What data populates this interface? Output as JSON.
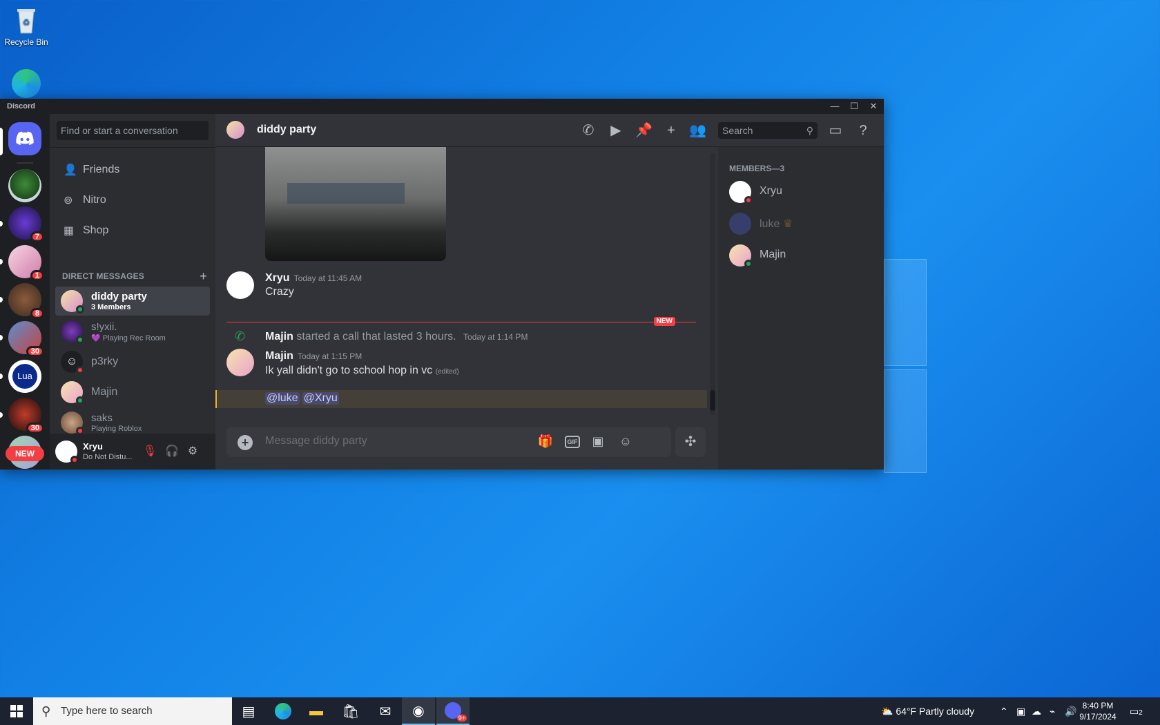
{
  "desktop": {
    "icons": [
      {
        "label": "Recycle Bin"
      }
    ]
  },
  "window": {
    "app_title": "Discord",
    "controls": {
      "minimize": "—",
      "maximize": "☐",
      "close": "✕"
    }
  },
  "guilds": {
    "items": [
      {
        "name": "home",
        "badge": ""
      },
      {
        "name": "tree-server",
        "badge": ""
      },
      {
        "name": "server-2",
        "badge": "7"
      },
      {
        "name": "server-3",
        "badge": "1"
      },
      {
        "name": "server-4",
        "badge": "8"
      },
      {
        "name": "server-5",
        "badge": "30"
      },
      {
        "name": "server-lua",
        "badge": "",
        "label": "Lua"
      },
      {
        "name": "server-7",
        "badge": "30"
      }
    ],
    "new_label": "NEW"
  },
  "dm_sidebar": {
    "search_placeholder": "Find or start a conversation",
    "nav": [
      {
        "label": "Friends"
      },
      {
        "label": "Nitro"
      },
      {
        "label": "Shop"
      }
    ],
    "header": "DIRECT MESSAGES",
    "header_plus": "+",
    "dms": [
      {
        "name": "diddy party",
        "sub": "3 Members"
      },
      {
        "name": "s!yxii.",
        "sub": "💜 Playing Rec Room"
      },
      {
        "name": "p3rky",
        "sub": ""
      },
      {
        "name": "Majin",
        "sub": ""
      },
      {
        "name": "saks",
        "sub": "Playing Roblox"
      }
    ]
  },
  "user_panel": {
    "name": "Xryu",
    "status": "Do Not Distu..."
  },
  "chat": {
    "title": "diddy party",
    "search_placeholder": "Search",
    "messages": [
      {
        "author": "Xryu",
        "time": "Today at 11:45 AM",
        "text": "Crazy"
      },
      {
        "author": "Majin",
        "time": "Today at 1:15 PM",
        "text": "Ik yall didn't go to school hop in vc",
        "edited": "(edited)"
      }
    ],
    "call": {
      "author": "Majin",
      "text": "started a call that lasted 3 hours.",
      "time": "Today at 1:14 PM"
    },
    "new_tag": "NEW",
    "mentions": [
      "@luke",
      "@Xryu"
    ],
    "composer_placeholder": "Message diddy party",
    "gif_label": "GIF"
  },
  "members": {
    "header": "MEMBERS—3",
    "list": [
      {
        "name": "Xryu"
      },
      {
        "name": "luke",
        "crown": "♛"
      },
      {
        "name": "Majin"
      }
    ]
  },
  "taskbar": {
    "search_placeholder": "Type here to search",
    "weather": "64°F  Partly cloudy",
    "time": "8:40 PM",
    "date": "9/17/2024",
    "notif_count": "2",
    "discord_badge": "9+"
  }
}
